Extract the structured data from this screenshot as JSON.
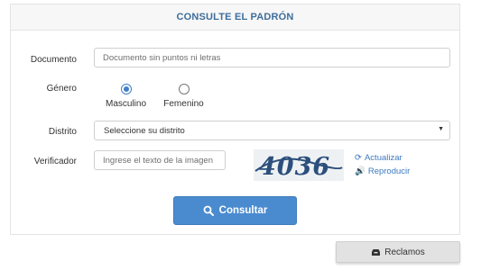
{
  "header": {
    "title": "CONSULTE EL PADRÓN"
  },
  "form": {
    "documento": {
      "label": "Documento",
      "placeholder": "Documento sin puntos ni letras",
      "value": ""
    },
    "genero": {
      "label": "Género",
      "options": [
        {
          "label": "Masculino",
          "checked": true
        },
        {
          "label": "Femenino",
          "checked": false
        }
      ]
    },
    "distrito": {
      "label": "Distrito",
      "selected": "Seleccione su distrito"
    },
    "verificador": {
      "label": "Verificador",
      "placeholder": "Ingrese el texto de la imagen",
      "value": "",
      "captcha_text": "4036",
      "refresh_label": "Actualizar",
      "audio_label": "Reproducir"
    }
  },
  "actions": {
    "consultar_label": "Consultar",
    "reclamos_label": "Reclamos"
  },
  "colors": {
    "accent": "#4a8bd0",
    "title": "#3d6e9b",
    "link": "#3d7ac0",
    "captcha_ink": "#2c4f7c"
  },
  "icons": {
    "consultar": "search-icon",
    "reclamos": "inbox-icon",
    "refresh": "refresh-icon",
    "audio": "volume-icon",
    "select_caret": "caret-down-icon"
  }
}
